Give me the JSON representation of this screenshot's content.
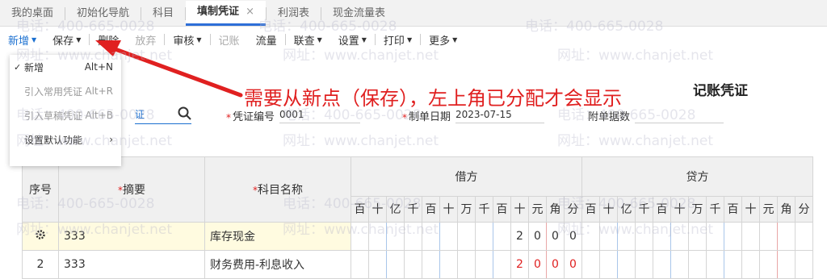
{
  "tabs": [
    {
      "label": "我的桌面"
    },
    {
      "label": "初始化导航"
    },
    {
      "label": "科目"
    },
    {
      "label": "填制凭证",
      "close": "×"
    },
    {
      "label": "利润表"
    },
    {
      "label": "现金流量表"
    }
  ],
  "toolbar": {
    "new": "新增",
    "save": "保存",
    "delete": "删除",
    "discard": "放弃",
    "audit": "审核",
    "post": "记账",
    "flow": "流量",
    "link": "联查",
    "settings": "设置",
    "print": "打印",
    "more": "更多"
  },
  "dropdown": {
    "check": "✓",
    "items": [
      {
        "label": "新增",
        "shortcut": "Alt+N"
      },
      {
        "label": "引入常用凭证",
        "shortcut": "Alt+R"
      },
      {
        "label": "引入草稿凭证",
        "shortcut": "Alt+B"
      },
      {
        "label": "设置默认功能",
        "shortcut": "›"
      }
    ]
  },
  "annotation": "需要从新点（保存），左上角已分配才会显示",
  "voucher": {
    "title": "记账凭证",
    "search_value": "证",
    "voucher_no_label": "凭证编号",
    "voucher_no": "0001",
    "date_label": "制单日期",
    "date": "2023-07-15",
    "attachments_label": "附单据数",
    "star": "*"
  },
  "grid": {
    "headers": {
      "seq": "序号",
      "summary": "摘要",
      "account": "科目名称",
      "debit": "借方",
      "credit": "贷方"
    },
    "digits": [
      "百",
      "十",
      "亿",
      "千",
      "百",
      "十",
      "万",
      "千",
      "百",
      "十",
      "元",
      "角",
      "分"
    ],
    "rows": [
      {
        "seq_icon": "gear-icon",
        "summary": "333",
        "account": "库存现金",
        "debit": [
          "",
          "",
          "",
          "",
          "",
          "",
          "",
          "",
          "",
          "2",
          "0",
          "0",
          "0"
        ],
        "credit": [
          "",
          "",
          "",
          "",
          "",
          "",
          "",
          "",
          "",
          "",
          "",
          "",
          ""
        ],
        "negative": false
      },
      {
        "seq": "2",
        "summary": "333",
        "account": "财务费用-利息收入",
        "debit": [
          "",
          "",
          "",
          "",
          "",
          "",
          "",
          "",
          "",
          "2",
          "0",
          "0",
          "0"
        ],
        "credit": [
          "",
          "",
          "",
          "",
          "",
          "",
          "",
          "",
          "",
          "",
          "",
          "",
          ""
        ],
        "negative": true
      }
    ]
  },
  "watermark": {
    "phone": "电话：400-665-0028",
    "site": "网址：www.chanjet.net"
  },
  "colors": {
    "accent": "#1a6fd0",
    "annotation": "#e02020",
    "highlight": "#fffbe0"
  }
}
